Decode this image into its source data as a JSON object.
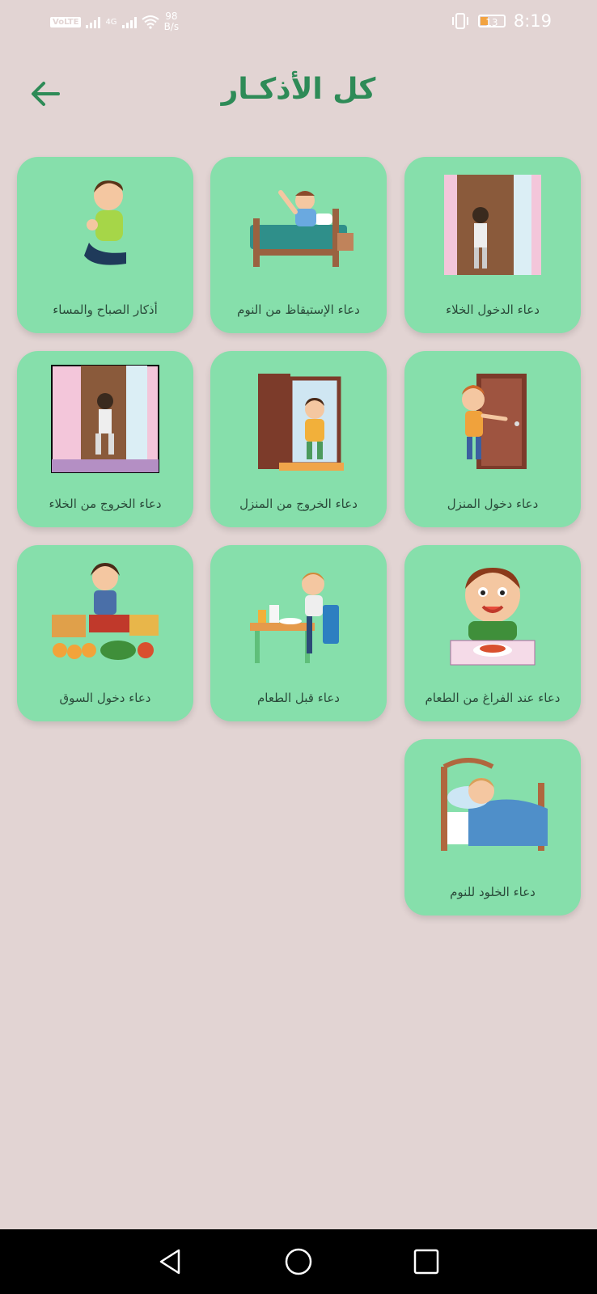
{
  "status_bar": {
    "volte": "VoLTE",
    "network": "4G",
    "speed_value": "98",
    "speed_unit": "B/s",
    "battery": "13",
    "time": "8:19"
  },
  "header": {
    "title": "كل الأذكـار",
    "back_icon": "arrow-left-icon"
  },
  "colors": {
    "background": "#e2d4d3",
    "card": "#86dfab",
    "accent": "#2e8b57"
  },
  "items": [
    {
      "label": "دعاء الدخول الخلاء",
      "icon": "restroom-enter-illustration"
    },
    {
      "label": "دعاء الإستيقاظ من النوم",
      "icon": "waking-up-illustration"
    },
    {
      "label": "أذكار الصباح والمساء",
      "icon": "praying-child-illustration"
    },
    {
      "label": "دعاء دخول المنزل",
      "icon": "enter-home-illustration"
    },
    {
      "label": "دعاء الخروج من المنزل",
      "icon": "leave-home-illustration"
    },
    {
      "label": "دعاء الخروج من الخلاء",
      "icon": "restroom-exit-illustration"
    },
    {
      "label": "دعاء عند الفراغ من الطعام",
      "icon": "after-meal-illustration"
    },
    {
      "label": "دعاء قبل  الطعام",
      "icon": "before-meal-illustration"
    },
    {
      "label": "دعاء دخول السوق",
      "icon": "market-illustration"
    },
    {
      "label": "دعاء الخلود للنوم",
      "icon": "sleeping-illustration"
    }
  ],
  "nav": {
    "back": "nav-back-icon",
    "home": "nav-home-icon",
    "recents": "nav-recents-icon"
  }
}
